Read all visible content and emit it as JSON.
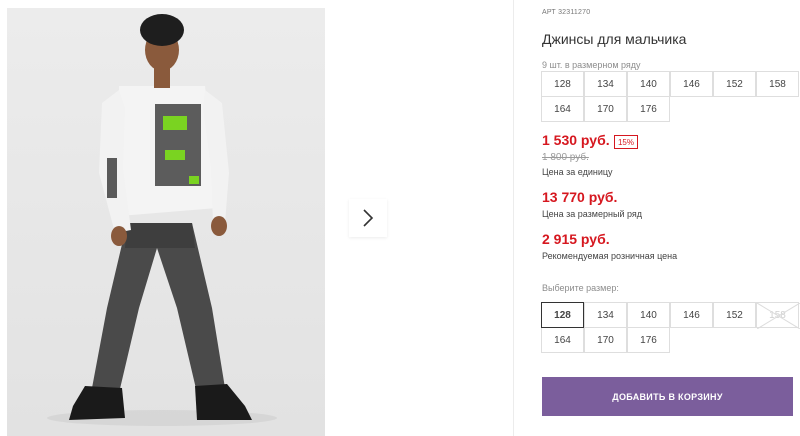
{
  "product": {
    "art_label": "АРТ",
    "art_number": "32311270",
    "title": "Джинсы для мальчика",
    "range_note": "9 шт. в размерном ряду",
    "range_sizes": [
      "128",
      "134",
      "140",
      "146",
      "152",
      "158",
      "164",
      "170",
      "176"
    ],
    "price_unit": "1 530 руб.",
    "discount": "15%",
    "old_price": "1 800 руб.",
    "price_unit_caption": "Цена за единицу",
    "price_range": "13 770 руб.",
    "price_range_caption": "Цена за размерный ряд",
    "price_retail": "2 915 руб.",
    "price_retail_caption": "Рекомендуемая розничная цена",
    "choose_size_label": "Выберите размер:",
    "size_options": [
      {
        "label": "128",
        "state": "selected"
      },
      {
        "label": "134",
        "state": "available"
      },
      {
        "label": "140",
        "state": "available"
      },
      {
        "label": "146",
        "state": "available"
      },
      {
        "label": "152",
        "state": "available"
      },
      {
        "label": "158",
        "state": "unavailable"
      },
      {
        "label": "164",
        "state": "available"
      },
      {
        "label": "170",
        "state": "available"
      },
      {
        "label": "176",
        "state": "available"
      }
    ],
    "add_to_cart": "ДОБАВИТЬ В КОРЗИНУ"
  },
  "colors": {
    "price_red": "#d6171f",
    "button_purple": "#7b5e9c"
  }
}
